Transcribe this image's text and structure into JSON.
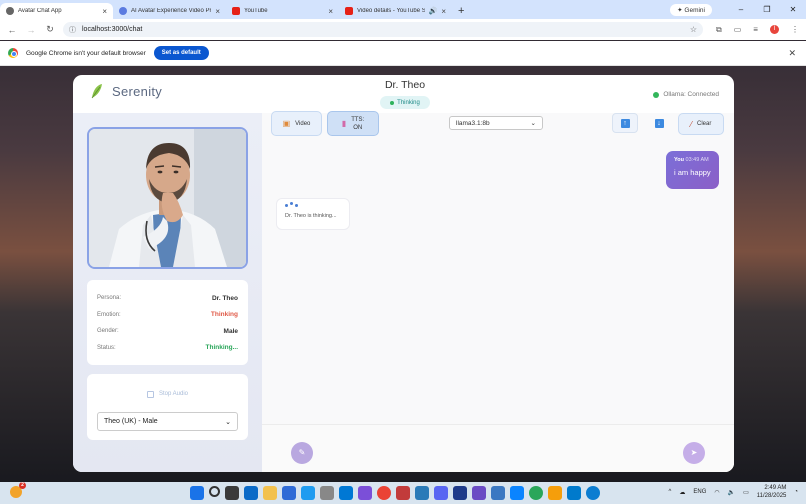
{
  "browser": {
    "tabs": [
      {
        "title": "Avatar Chat App",
        "active": true,
        "icon": "globe-icon"
      },
      {
        "title": "AI Avatar Experience Video Pro",
        "active": false,
        "icon": "ai-icon"
      },
      {
        "title": "YouTube",
        "active": false,
        "icon": "youtube-icon"
      },
      {
        "title": "Video details - YouTube St",
        "active": false,
        "icon": "youtube-icon"
      }
    ],
    "gemini_label": "Gemini",
    "url": "localhost:3000/chat",
    "infobar": {
      "message": "Google Chrome isn't your default browser",
      "button": "Set as default"
    }
  },
  "app": {
    "brand": "Serenity",
    "header": {
      "name": "Dr. Theo",
      "state": "Thinking"
    },
    "connection": "Ollama: Connected",
    "persona": [
      {
        "key": "Persona:",
        "value": "Dr. Theo",
        "tone": "default"
      },
      {
        "key": "Emotion:",
        "value": "Thinking",
        "tone": "red"
      },
      {
        "key": "Gender:",
        "value": "Male",
        "tone": "default"
      },
      {
        "key": "Status:",
        "value": "Thinking...",
        "tone": "green"
      }
    ],
    "audio": {
      "stop_label": "Stop Audio",
      "voice": "Theo (UK) - Male"
    },
    "controls": {
      "video_label": "Video",
      "tts_label_1": "TTS:",
      "tts_label_2": "ON",
      "model": "llama3.1:8b",
      "clear_label": "Clear"
    },
    "messages": {
      "user": {
        "sender": "You",
        "time": "03:49 AM",
        "text": "i am happy"
      },
      "bot": {
        "status": "Dr. Theo is thinking..."
      }
    }
  },
  "taskbar": {
    "notification_count": "2",
    "language": "ENG",
    "time": "2:49 AM",
    "date": "11/28/2025"
  },
  "colors": {
    "accent": "#7b6fd8",
    "emotion_red": "#e05a47",
    "status_green": "#2aa65a",
    "brand_text": "#5b6880"
  }
}
